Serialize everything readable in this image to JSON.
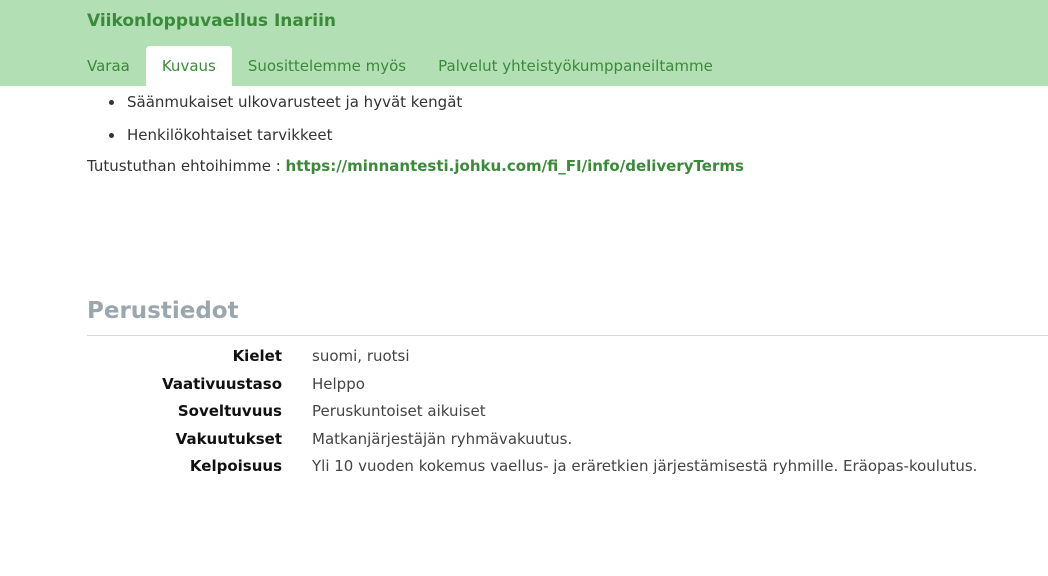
{
  "header": {
    "title": "Viikonloppuvaellus Inariin",
    "tabs": [
      {
        "label": "Varaa"
      },
      {
        "label": "Kuvaus"
      },
      {
        "label": "Suosittelemme myös"
      },
      {
        "label": "Palvelut yhteistyökumppaneiltamme"
      }
    ],
    "active_tab": "Kuvaus"
  },
  "main": {
    "requirements": [
      "Säänmukaiset ulkovarusteet ja hyvät kengät",
      "Henkilökohtaiset tarvikkeet"
    ],
    "terms_prefix": "Tutustuthan ehtoihimme : ",
    "terms_link": "https://minnantesti.johku.com/fi_FI/info/deliveryTerms",
    "section_title": "Perustiedot",
    "info": [
      {
        "label": "Kielet",
        "value": "suomi, ruotsi"
      },
      {
        "label": "Vaativuustaso",
        "value": "Helppo"
      },
      {
        "label": "Soveltuvuus",
        "value": "Peruskuntoiset aikuiset"
      },
      {
        "label": "Vakuutukset",
        "value": "Matkanjärjestäjän ryhmävakuutus."
      },
      {
        "label": "Kelpoisuus",
        "value": "Yli 10 vuoden kokemus vaellus- ja eräretkien järjestämisestä ryhmille. Eräopas-koulutus."
      }
    ]
  },
  "colors": {
    "header_bg": "#b2dfb4",
    "accent_green": "#3a8a3a",
    "section_title": "#9aa7ae"
  }
}
